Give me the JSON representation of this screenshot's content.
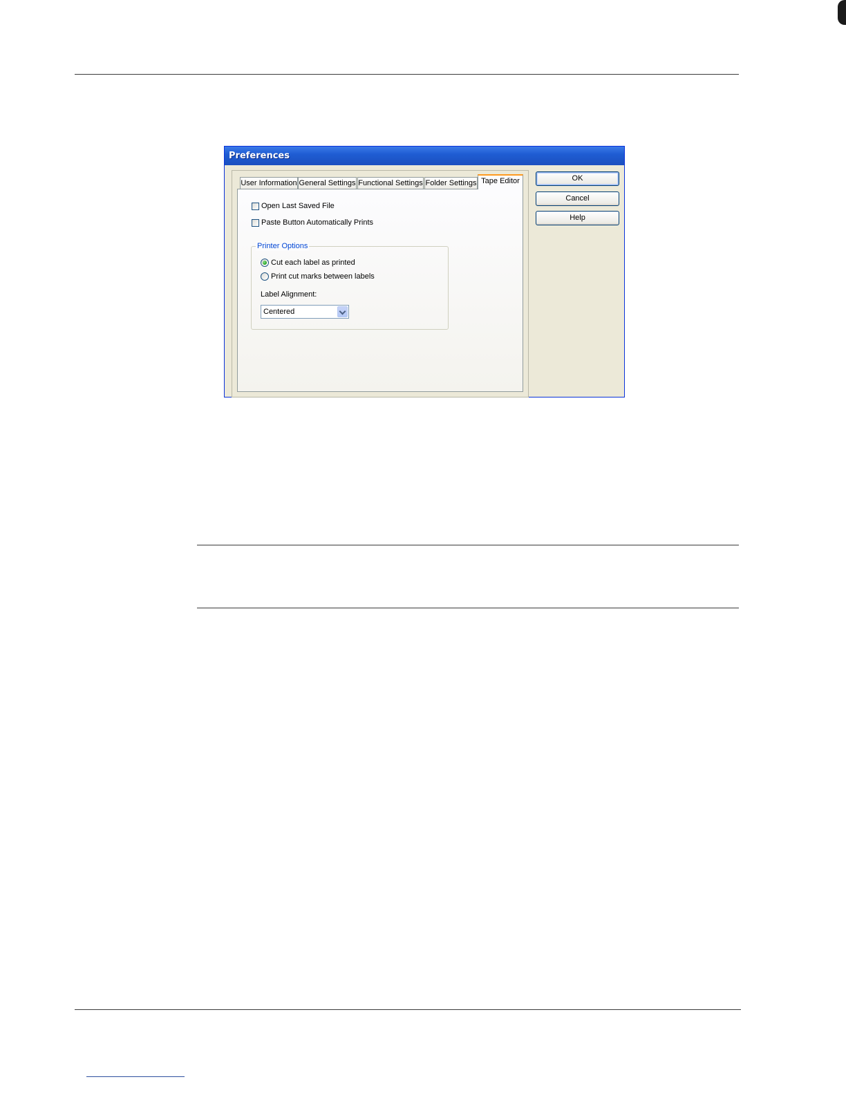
{
  "dialog": {
    "title": "Preferences",
    "tabs": [
      {
        "label": "User Information",
        "active": false
      },
      {
        "label": "General Settings",
        "active": false
      },
      {
        "label": "Functional Settings",
        "active": false
      },
      {
        "label": "Folder Settings",
        "active": false
      },
      {
        "label": "Tape Editor",
        "active": true
      }
    ],
    "options": {
      "open_last_saved": {
        "label": "Open Last Saved File",
        "checked": false
      },
      "paste_auto_print": {
        "label": "Paste Button Automatically Prints",
        "checked": false
      }
    },
    "printer_options": {
      "legend": "Printer Options",
      "radio_cut_each": {
        "label": "Cut each label as printed",
        "checked": true
      },
      "radio_cut_marks": {
        "label": "Print cut marks between labels",
        "checked": false
      },
      "alignment_label": "Label Alignment:",
      "alignment_value": "Centered"
    },
    "buttons": {
      "ok": "OK",
      "cancel": "Cancel",
      "help": "Help"
    }
  },
  "colors": {
    "titlebar": "#1f5dd3",
    "dialog_bg": "#ece9d8",
    "active_tab_accent": "#ff9a1f",
    "group_legend": "#0046d5"
  }
}
